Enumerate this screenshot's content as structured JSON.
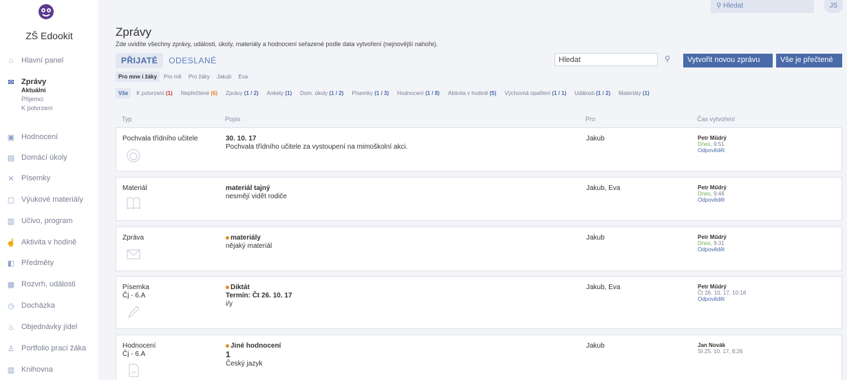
{
  "sidebar": {
    "school": "ZŠ Edookit",
    "items": [
      {
        "label": "Hlavní panel",
        "icon": "home-icon"
      },
      {
        "label": "Zprávy",
        "icon": "mail-icon"
      },
      {
        "label": "Hodnocení",
        "icon": "grade-icon"
      },
      {
        "label": "Domácí úkoly",
        "icon": "briefcase-icon"
      },
      {
        "label": "Písemky",
        "icon": "tools-icon"
      },
      {
        "label": "Výukové materiály",
        "icon": "document-icon"
      },
      {
        "label": "Učivo, program",
        "icon": "book-icon"
      },
      {
        "label": "Aktivita v hodině",
        "icon": "hand-icon"
      },
      {
        "label": "Předměty",
        "icon": "subjects-icon"
      },
      {
        "label": "Rozvrh, události",
        "icon": "calendar-icon"
      },
      {
        "label": "Docházka",
        "icon": "clock-icon"
      },
      {
        "label": "Objednávky jídel",
        "icon": "food-icon"
      },
      {
        "label": "Portfolio prací žáka",
        "icon": "user-icon"
      },
      {
        "label": "Knihovna",
        "icon": "library-icon"
      }
    ],
    "subitems": [
      "Aktuální",
      "Přijemci",
      "K potvrzení"
    ]
  },
  "topbar": {
    "search_placeholder": "Hledat",
    "avatar": "JS"
  },
  "page": {
    "title": "Zprávy",
    "subtitle": "Zde uvidíte všechny zprávy, události, úkoly, materiály a hodnocení seřazené podle data vytvoření (nejnovější nahoře)."
  },
  "tabs": [
    "PŘIJATÉ",
    "ODESLANÉ"
  ],
  "search": {
    "value": "Hledat"
  },
  "buttons": {
    "new_message": "Vytvořit novou zprávu",
    "all_read": "Vše je přečtené"
  },
  "filter1": [
    "Pro mne i žáky",
    "Pro mě",
    "Pro žáky",
    "Jakub",
    "Eva"
  ],
  "filter2": [
    {
      "label": "Vše",
      "count": ""
    },
    {
      "label": "K potvrzení",
      "count": "(1)"
    },
    {
      "label": "Nepřečtené",
      "count": "(6)"
    },
    {
      "label": "Zprávy",
      "count": "(1 / 2)"
    },
    {
      "label": "Ankety",
      "count": "(1)"
    },
    {
      "label": "Dom. úkoly",
      "count": "(1 / 2)"
    },
    {
      "label": "Písemky",
      "count": "(1 / 3)"
    },
    {
      "label": "Hodnocení",
      "count": "(1 / 8)"
    },
    {
      "label": "Aktivita v hodině",
      "count": "(5)"
    },
    {
      "label": "Výchovná opatření",
      "count": "(1 / 1)"
    },
    {
      "label": "Události",
      "count": "(1 / 2)"
    },
    {
      "label": "Materiály",
      "count": "(1)"
    }
  ],
  "table": {
    "headers": [
      "Typ",
      "Popis",
      "Pro",
      "Čas vytvoření"
    ],
    "rows": [
      {
        "type": "Pochvala třídního učitele",
        "type2": "",
        "title": "30. 10. 17",
        "line2": "Pochvala třídního učitele za vystoupení na mimoškolní akci.",
        "line3": "",
        "for": "Jakub",
        "author": "Petr Műdrý",
        "date": "Dnes",
        "time": ", 9:51",
        "reply": "Odpovědět",
        "icon": "medal-icon"
      },
      {
        "type": "Materiál",
        "type2": "",
        "title": "materiál tajný",
        "line2": "nesmějí vidět rodiče",
        "line3": "",
        "for": "Jakub, Eva",
        "author": "Petr Műdrý",
        "date": "Dnes",
        "time": ", 9:46",
        "reply": "Odpovědět",
        "icon": "book-open-icon"
      },
      {
        "type": "Zpráva",
        "type2": "",
        "title": "materiály",
        "line2": "nějaký materiál",
        "line3": "",
        "for": "Jakub",
        "author": "Petr Műdrý",
        "date": "Dnes",
        "time": ", 9:31",
        "reply": "Odpovědět",
        "icon": "envelope-icon"
      },
      {
        "type": "Písemka",
        "type2": "Čj - 6.A",
        "title": "Diktát",
        "line2": "Termín:  Čt 26. 10. 17",
        "line3": "i/y",
        "for": "Jakub, Eva",
        "author": "Petr Műdrý",
        "date": "Čt 26. 10. 17",
        "time": ", 10:18",
        "reply": "Odpovědět",
        "icon": "pen-icon"
      },
      {
        "type": "Hodnocení",
        "type2": "Čj - 6.A",
        "title": "Jiné hodnocení",
        "line2": "1",
        "line3": "Český jazyk",
        "for": "Jakub",
        "author": "Jan Novák",
        "date": "St 25. 10. 17",
        "time": ", 8:26",
        "reply": "",
        "icon": "grade-doc-icon"
      }
    ]
  },
  "colors": {
    "accent": "#4a6aa8",
    "background": "#f3f4f8",
    "unread_dot": "#e08b1e"
  }
}
